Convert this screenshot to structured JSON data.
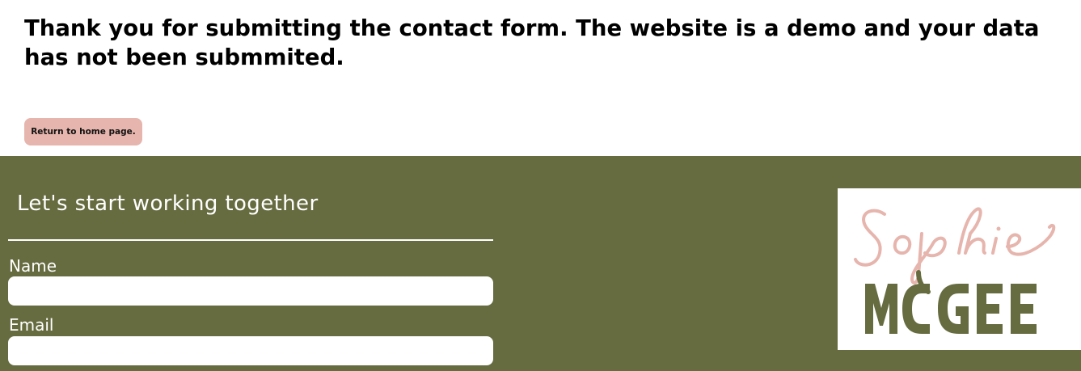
{
  "message": {
    "thanks_text": "Thank you for submitting the contact form. The website is a demo and your data has not been submmited."
  },
  "actions": {
    "return_home_label": "Return to home page."
  },
  "footer": {
    "heading": "Let's start working together",
    "form": {
      "name_label": "Name",
      "name_value": "",
      "email_label": "Email",
      "email_value": ""
    },
    "logo": {
      "script_text": "Sophie",
      "block_text": "MCGEE"
    }
  },
  "colors": {
    "footer_bg": "#676c40",
    "button_bg": "#e6b5ad",
    "logo_pink": "#e6b5ad",
    "logo_olive": "#676c40"
  }
}
